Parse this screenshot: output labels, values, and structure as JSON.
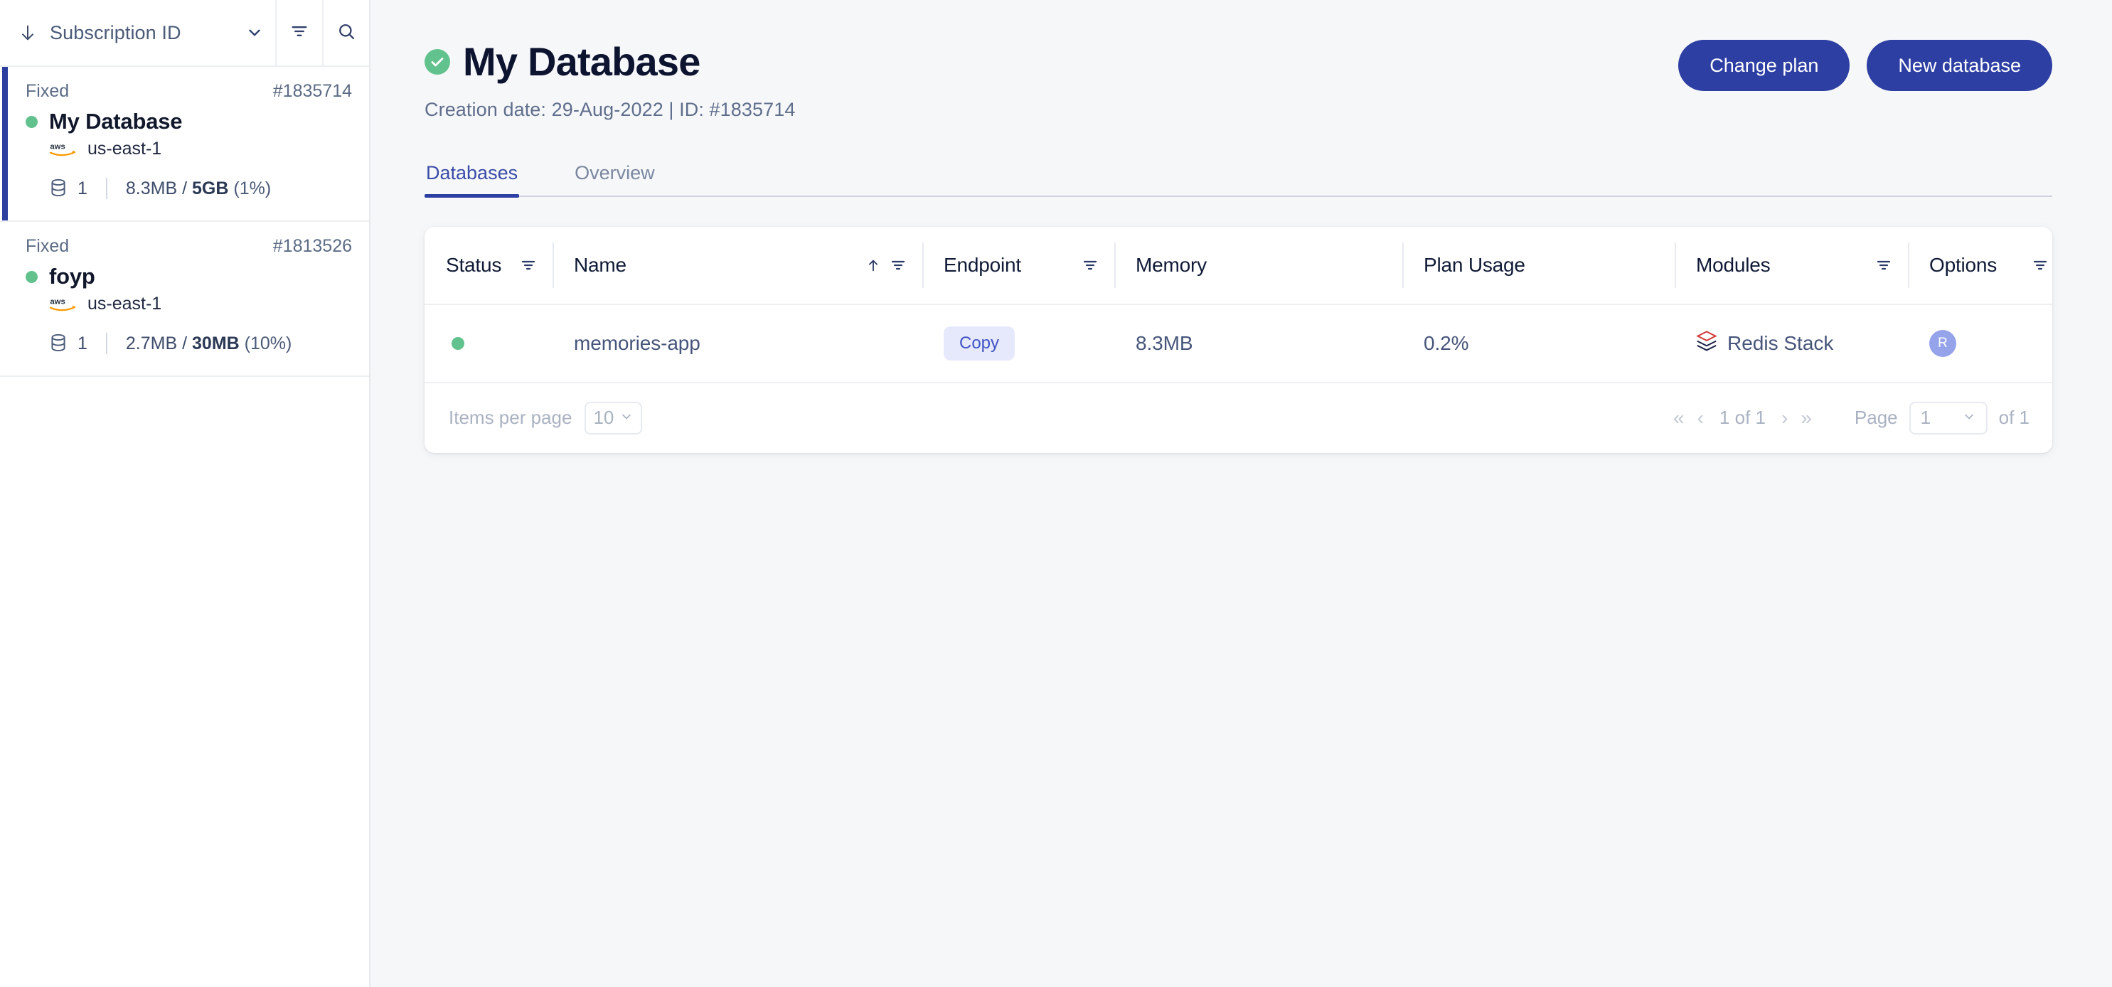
{
  "sidebar": {
    "toolbar": {
      "sort_icon": "down-arrow-icon",
      "select_label": "Subscription ID",
      "chevron_icon": "chevron-down-icon",
      "filter_icon": "filter-icon",
      "search_icon": "search-icon"
    },
    "items": [
      {
        "plan": "Fixed",
        "id": "#1835714",
        "name": "My Database",
        "cloud": "aws",
        "region": "us-east-1",
        "db_count": "1",
        "used": "8.3MB",
        "separator": " / ",
        "total": "5GB",
        "percent": "(1%)",
        "selected": true,
        "status": "active"
      },
      {
        "plan": "Fixed",
        "id": "#1813526",
        "name": "foyp",
        "cloud": "aws",
        "region": "us-east-1",
        "db_count": "1",
        "used": "2.7MB",
        "separator": " / ",
        "total": "30MB",
        "percent": "(10%)",
        "selected": false,
        "status": "active"
      }
    ]
  },
  "header": {
    "status_icon": "check-circle-icon",
    "title": "My Database",
    "subtitle": "Creation date: 29-Aug-2022 | ID: #1835714",
    "change_plan_label": "Change plan",
    "new_database_label": "New database"
  },
  "tabs": [
    {
      "label": "Databases",
      "active": true
    },
    {
      "label": "Overview",
      "active": false
    }
  ],
  "table": {
    "columns": [
      {
        "label": "Status",
        "filter": true,
        "sort": false
      },
      {
        "label": "Name",
        "filter": true,
        "sort": true
      },
      {
        "label": "Endpoint",
        "filter": true,
        "sort": false
      },
      {
        "label": "Memory",
        "filter": false,
        "sort": false
      },
      {
        "label": "Plan Usage",
        "filter": false,
        "sort": false
      },
      {
        "label": "Modules",
        "filter": true,
        "sort": false
      },
      {
        "label": "Options",
        "filter": true,
        "sort": false
      }
    ],
    "rows": [
      {
        "status": "active",
        "name": "memories-app",
        "endpoint_label": "Copy",
        "memory": "8.3MB",
        "plan_usage": "0.2%",
        "module_icon": "redis-stack-icon",
        "module": "Redis Stack",
        "option_avatar": "R"
      }
    ],
    "footer": {
      "items_per_page_label": "Items per page",
      "items_per_page_value": "10",
      "first_icon": "«",
      "prev_icon": "‹",
      "range_text": "1 of 1",
      "next_icon": "›",
      "last_icon": "»",
      "page_label": "Page",
      "page_value": "1",
      "page_of": "of 1"
    }
  },
  "colors": {
    "brand_blue": "#2e3fa3",
    "accent_blue": "#3a4ba8",
    "status_green": "#62c28d",
    "chip_bg": "#e6e9fb",
    "chip_text": "#3f53c4",
    "avatar_bg": "#94a3ea",
    "page_bg": "#f6f7f9",
    "text_dark": "#0d1430",
    "text_muted": "#5f6e8c"
  }
}
